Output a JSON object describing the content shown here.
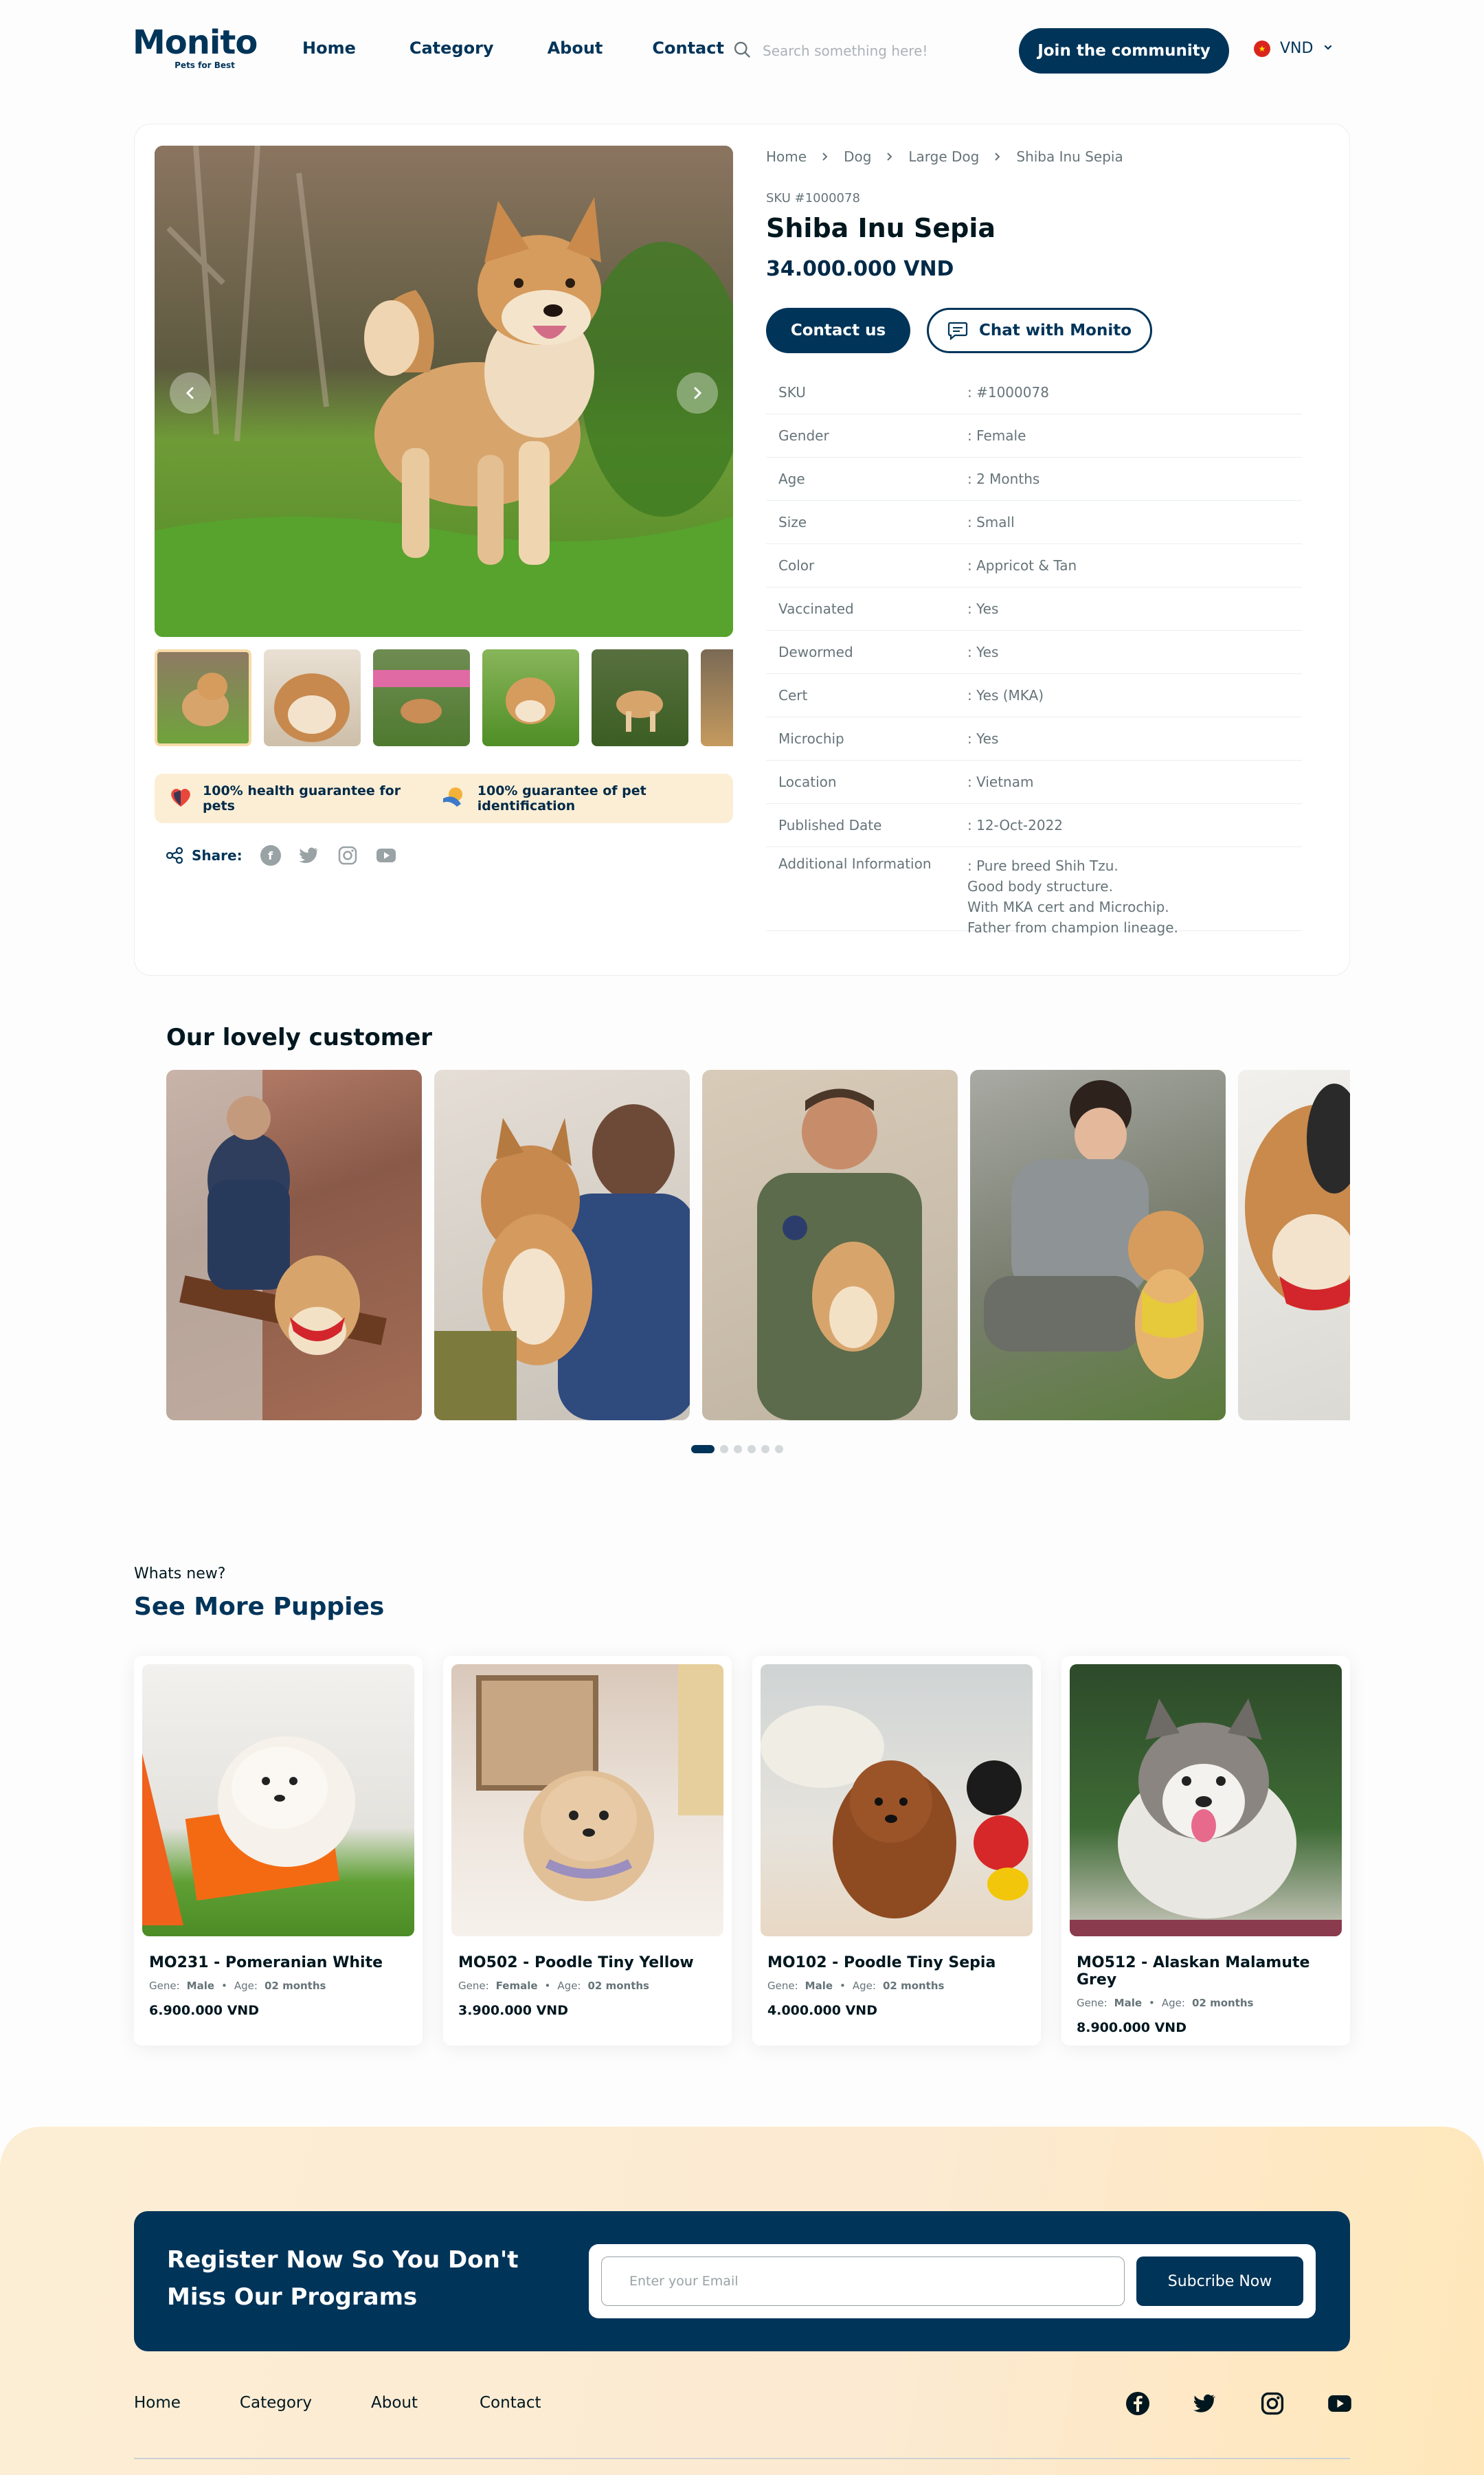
{
  "header": {
    "logo": "Monito",
    "tagline": "Pets for Best",
    "nav": [
      "Home",
      "Category",
      "About",
      "Contact"
    ],
    "search_placeholder": "Search something here!",
    "join_label": "Join the community",
    "currency": "VND"
  },
  "product": {
    "breadcrumb": [
      "Home",
      "Dog",
      "Large Dog",
      "Shiba Inu Sepia"
    ],
    "sku_label": "SKU #1000078",
    "title": "Shiba Inu Sepia",
    "price": "34.000.000 VND",
    "contact_label": "Contact us",
    "chat_label": "Chat with Monito",
    "specs": [
      {
        "key": "SKU",
        "value": ": #1000078"
      },
      {
        "key": "Gender",
        "value": ": Female"
      },
      {
        "key": "Age",
        "value": ": 2 Months"
      },
      {
        "key": "Size",
        "value": ": Small"
      },
      {
        "key": "Color",
        "value": ": Appricot & Tan"
      },
      {
        "key": "Vaccinated",
        "value": ": Yes"
      },
      {
        "key": "Dewormed",
        "value": ": Yes"
      },
      {
        "key": "Cert",
        "value": ": Yes (MKA)"
      },
      {
        "key": "Microchip",
        "value": ": Yes"
      },
      {
        "key": "Location",
        "value": ": Vietnam"
      },
      {
        "key": "Published Date",
        "value": ": 12-Oct-2022"
      },
      {
        "key": "Additional Information",
        "value": ": Pure breed Shih Tzu.\n  Good body structure.\n  With MKA cert and Microchip.\n  Father from champion lineage."
      }
    ],
    "guarantee_health": "100% health guarantee for pets",
    "guarantee_id": "100% guarantee of pet identification",
    "share_label": "Share:"
  },
  "customers": {
    "title": "Our lovely customer",
    "slide_count": 6,
    "active_slide": 1
  },
  "puppies": {
    "eyebrow": "Whats new?",
    "title": "See More Puppies",
    "items": [
      {
        "name": "MO231 - Pomeranian White",
        "gene_label": "Gene:",
        "gene": "Male",
        "age_label": "Age:",
        "age": "02 months",
        "price": "6.900.000 VND"
      },
      {
        "name": "MO502 - Poodle Tiny Yellow",
        "gene_label": "Gene:",
        "gene": "Female",
        "age_label": "Age:",
        "age": "02 months",
        "price": "3.900.000 VND"
      },
      {
        "name": "MO102 - Poodle Tiny Sepia",
        "gene_label": "Gene:",
        "gene": "Male",
        "age_label": "Age:",
        "age": "02 months",
        "price": "4.000.000 VND"
      },
      {
        "name": "MO512 - Alaskan Malamute Grey",
        "gene_label": "Gene:",
        "gene": "Male",
        "age_label": "Age:",
        "age": "02 months",
        "price": "8.900.000 VND"
      }
    ]
  },
  "footer": {
    "register_text": "Register Now So You Don't Miss Our Programs",
    "email_placeholder": "Enter your Email",
    "subscribe_label": "Subcribe Now",
    "nav": [
      "Home",
      "Category",
      "About",
      "Contact"
    ]
  },
  "colors": {
    "primary": "#003459",
    "accent_bg": "#fceed5",
    "text_muted": "#667479"
  }
}
